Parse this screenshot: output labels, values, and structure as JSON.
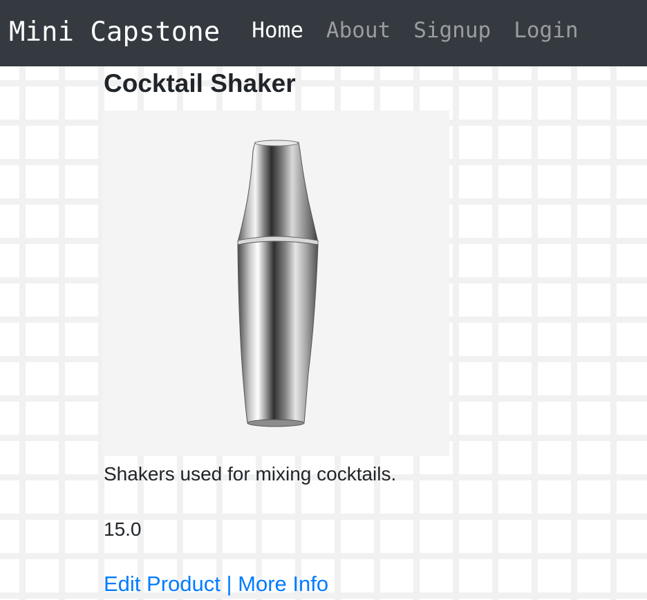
{
  "navbar": {
    "brand": "Mini Capstone",
    "links": [
      {
        "label": "Home",
        "active": true
      },
      {
        "label": "About",
        "active": false
      },
      {
        "label": "Signup",
        "active": false
      },
      {
        "label": "Login",
        "active": false
      }
    ]
  },
  "product": {
    "name": "Cocktail Shaker",
    "image_subject": "cocktail-shaker-image",
    "description": "Shakers used for mixing cocktails.",
    "price": "15.0"
  },
  "actions": {
    "edit_label": "Edit Product",
    "separator": " | ",
    "more_label": "More Info"
  },
  "colors": {
    "navbar_bg": "#343a40",
    "link": "#007bff",
    "text": "#212529"
  }
}
